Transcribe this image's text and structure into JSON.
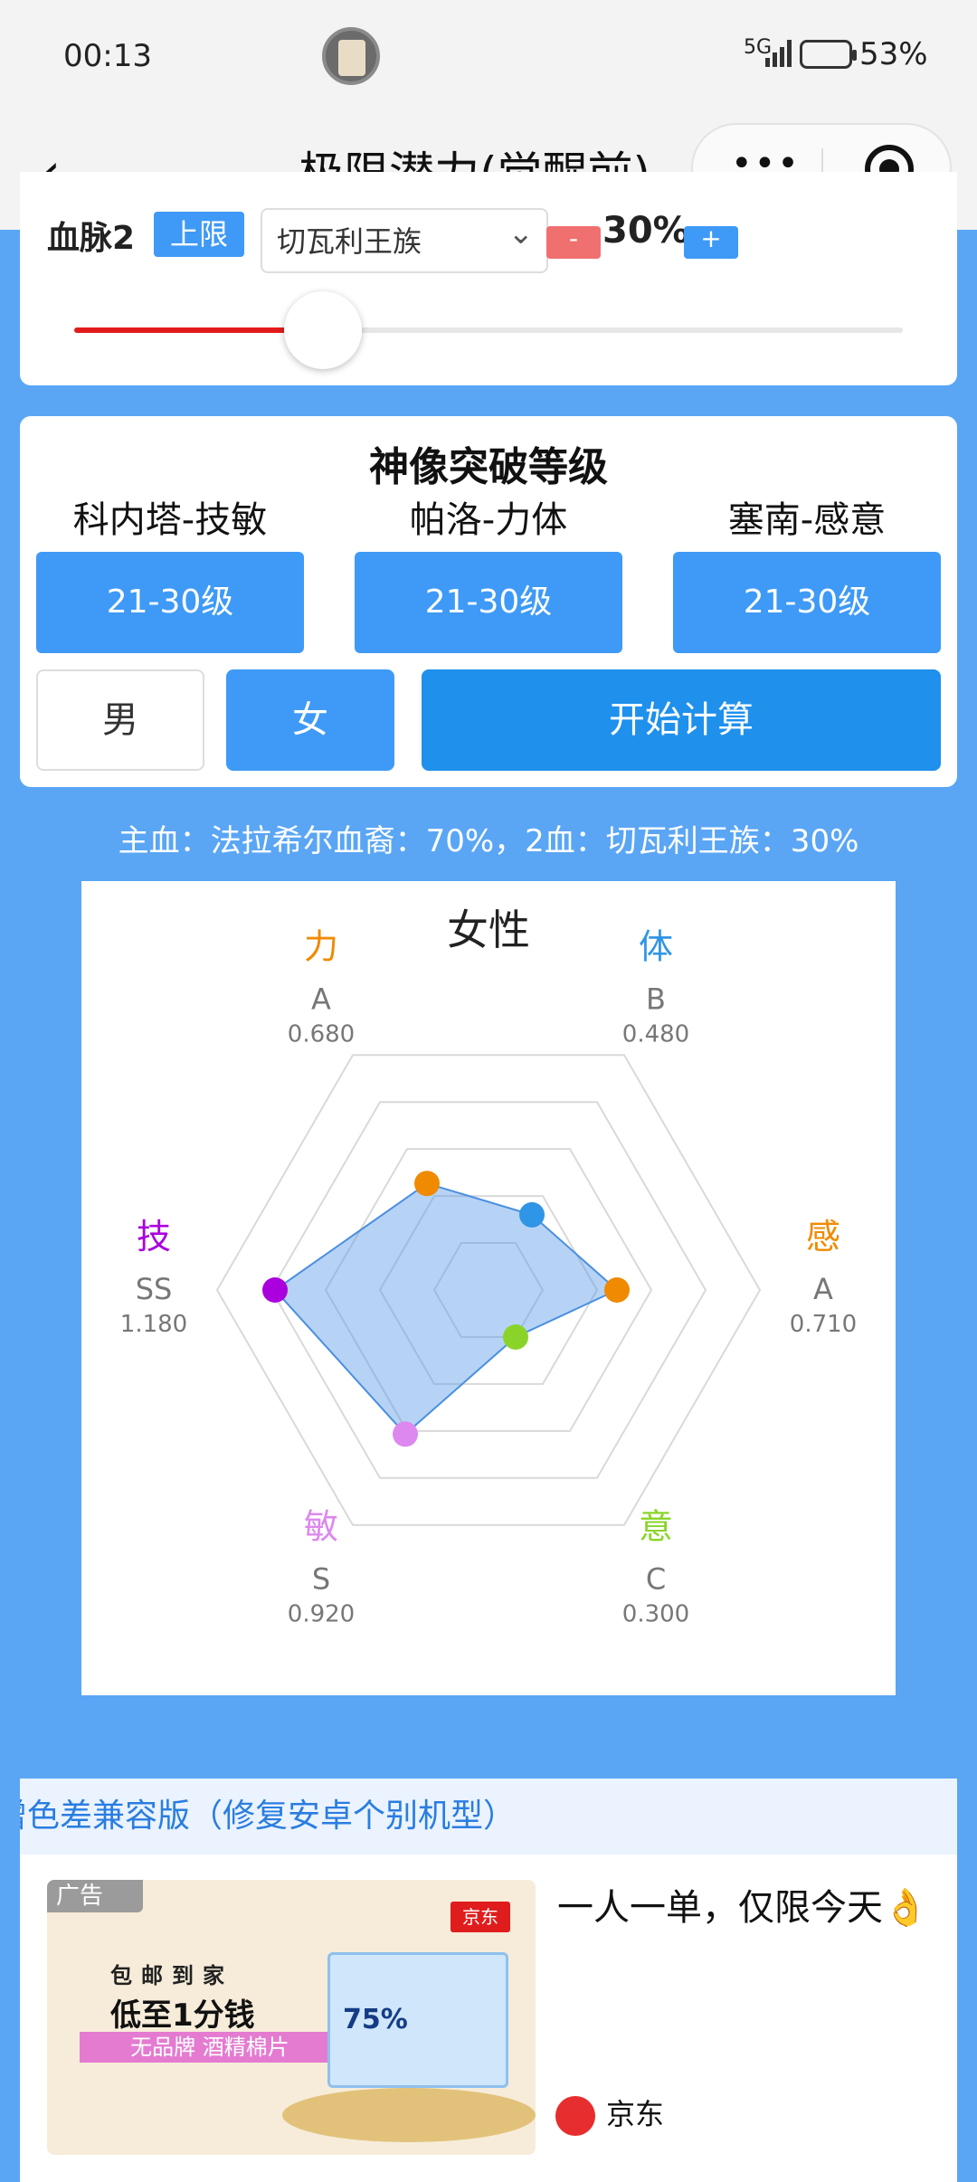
{
  "status": {
    "time": "00:13",
    "signal": "5G",
    "battery": "53%"
  },
  "nav": {
    "back_icon": "‹",
    "title": "极限潜力(觉醒前)",
    "more_icon": "•••"
  },
  "bloodline2": {
    "label": "血脉2",
    "limit_label": "上限",
    "selected": "切瓦利王族",
    "minus": "-",
    "percent": "30%",
    "plus": "+",
    "slider_fraction": 0.3
  },
  "breakthrough": {
    "title": "神像突破等级",
    "columns": [
      {
        "label": "科内塔-技敏",
        "value": "21-30级"
      },
      {
        "label": "帕洛-力体",
        "value": "21-30级"
      },
      {
        "label": "塞南-感意",
        "value": "21-30级"
      }
    ],
    "male": "男",
    "female": "女",
    "calculate": "开始计算"
  },
  "summary": "主血：法拉希尔血裔：70%，2血：切瓦利王族：30%",
  "chart_data": {
    "type": "radar",
    "title": "女性",
    "max": 1.5,
    "axes": [
      {
        "name": "力",
        "grade": "A",
        "value": 0.68,
        "color": "#f08a00"
      },
      {
        "name": "体",
        "grade": "B",
        "value": 0.48,
        "color": "#2f95e6"
      },
      {
        "name": "感",
        "grade": "A",
        "value": 0.71,
        "color": "#f08a00"
      },
      {
        "name": "意",
        "grade": "C",
        "value": 0.3,
        "color": "#8ad42a"
      },
      {
        "name": "敏",
        "grade": "S",
        "value": 0.92,
        "color": "#dd88ee"
      },
      {
        "name": "技",
        "grade": "SS",
        "value": 1.18,
        "color": "#aa00dd"
      }
    ],
    "value_labels": [
      "0.680",
      "0.480",
      "0.710",
      "0.300",
      "0.920",
      "1.180"
    ]
  },
  "ad": {
    "header": "增色差兼容版（修复安卓个别机型）",
    "tag": "广告",
    "brand_badge": "京东",
    "line1": "包邮到家",
    "line2": "低至1分钱",
    "line3": "无品牌 酒精棉片",
    "box_text": "75%",
    "headline": "一人一单，仅限今天👌",
    "brand": "京东"
  }
}
